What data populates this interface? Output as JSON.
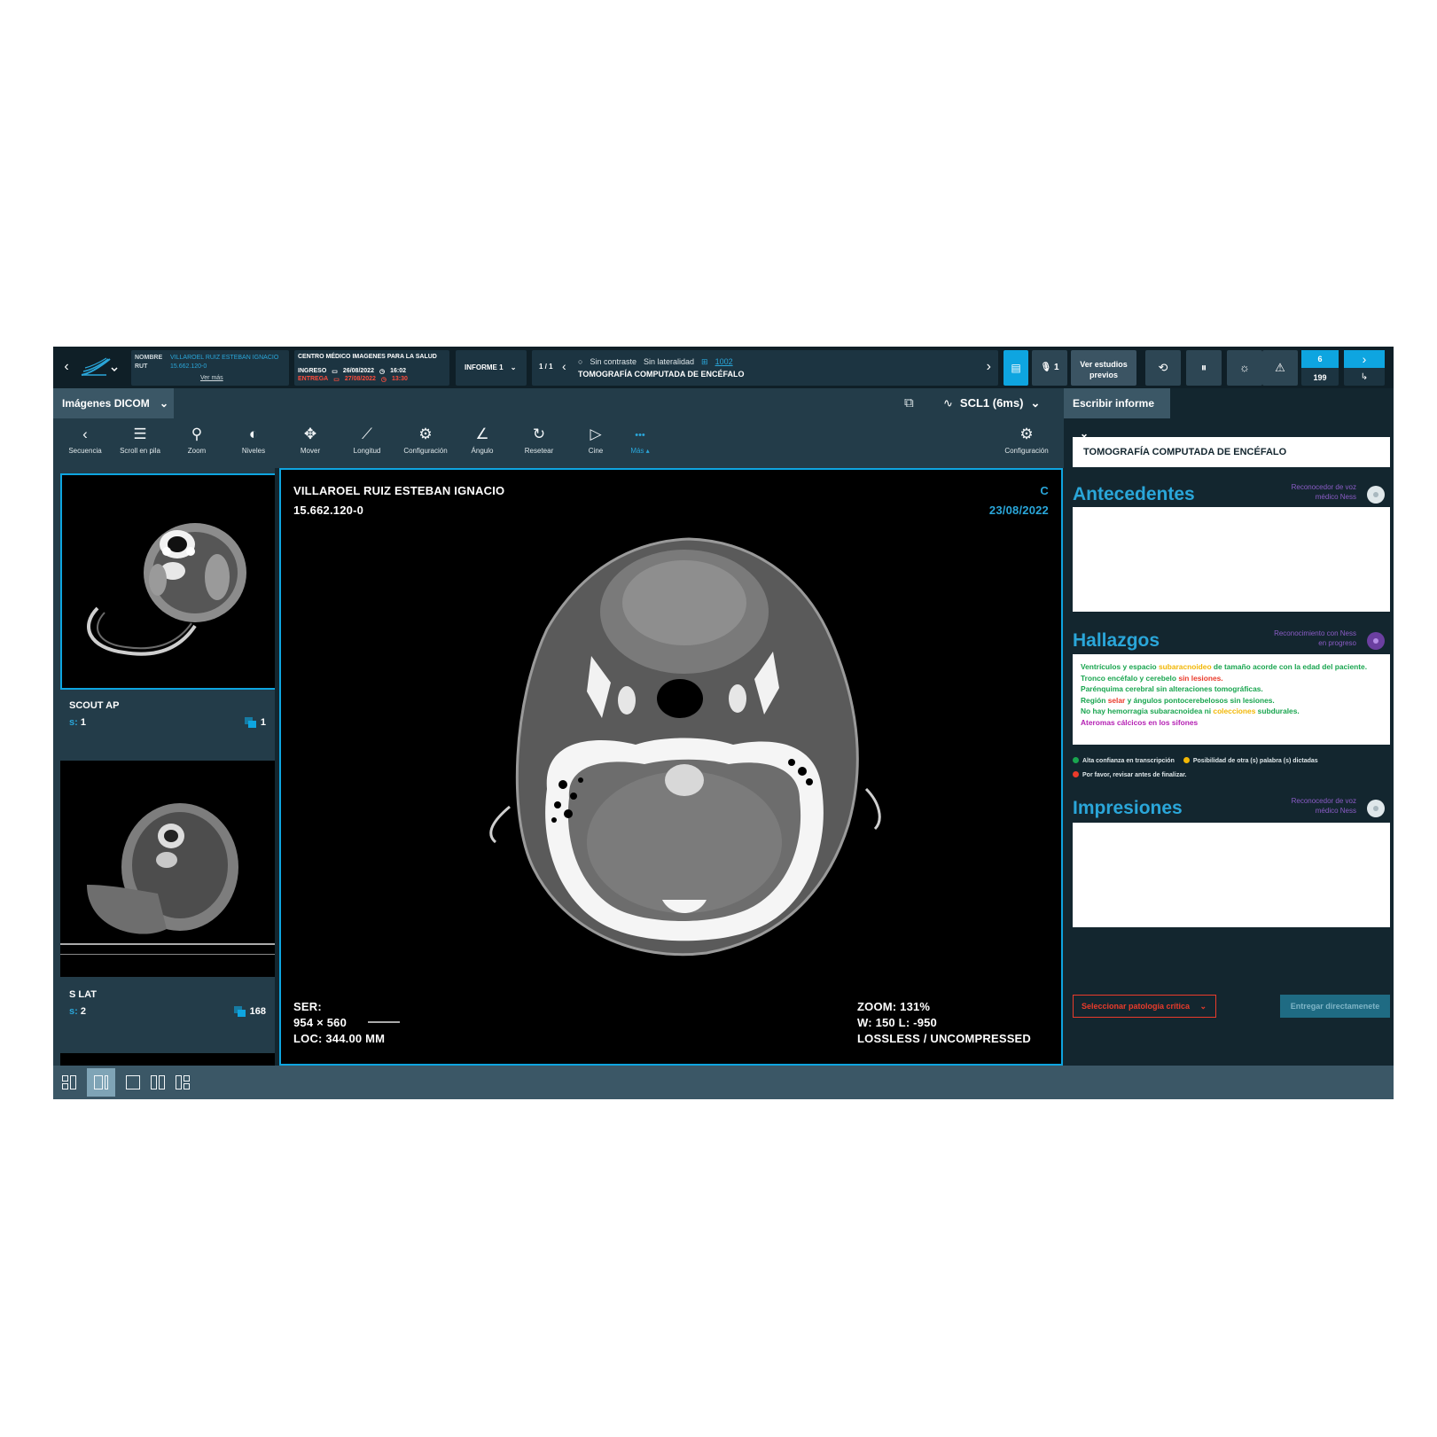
{
  "topbar": {
    "patient": {
      "name_label": "NOMBRE",
      "name": "VILLAROEL RUIZ ESTEBAN IGNACIO",
      "rut_label": "RUT",
      "rut": "15.662.120-0",
      "more": "Ver más"
    },
    "center": {
      "title": "CENTRO MÉDICO IMAGENES PARA LA SALUD",
      "ingreso_label": "INGRESO",
      "ingreso_date": "26/08/2022",
      "ingreso_time": "16:02",
      "entrega_label": "ENTREGA",
      "entrega_date": "27/08/2022",
      "entrega_time": "13:30"
    },
    "informe": "INFORME 1",
    "study": {
      "pager": "1 / 1",
      "contrast": "Sin contraste",
      "laterality": "Sin lateralidad",
      "code": "1002",
      "name": "TOMOGRAFÍA COMPUTADA DE ENCÉFALO"
    },
    "mic_count": "1",
    "prev_studies": [
      "Ver estudios",
      "previos"
    ],
    "counter_top": "6",
    "counter_bottom": "199"
  },
  "viewer": {
    "dropdown": "Imágenes DICOM",
    "series": "SCL1 (6ms)",
    "tools": [
      {
        "label": "Secuencia",
        "icon": "‹"
      },
      {
        "label": "Scroll en pila",
        "icon": "☰"
      },
      {
        "label": "Zoom",
        "icon": "⚲"
      },
      {
        "label": "Niveles",
        "icon": "◐"
      },
      {
        "label": "Mover",
        "icon": "✥"
      },
      {
        "label": "Longitud",
        "icon": "⟋"
      },
      {
        "label": "Configuración",
        "icon": "⚙"
      },
      {
        "label": "Ángulo",
        "icon": "∠"
      },
      {
        "label": "Resetear",
        "icon": "↻"
      },
      {
        "label": "Cine",
        "icon": "▷"
      },
      {
        "label": "Más ▴",
        "icon": "•••"
      }
    ],
    "config_label": "Configuración",
    "thumbnails": [
      {
        "title": "SCOUT AP",
        "s_label": "s:",
        "s": "1",
        "count": "1"
      },
      {
        "title": "S LAT",
        "s_label": "s:",
        "s": "2",
        "count": "168"
      }
    ],
    "overlay": {
      "patient_name": "VILLAROEL RUIZ ESTEBAN IGNACIO",
      "patient_rut": "15.662.120-0",
      "orientation": "C",
      "date": "23/08/2022",
      "ser": "SER:",
      "dims": "954 × 560",
      "loc": "LOC: 344.00 MM",
      "zoom": "ZOOM: 131%",
      "wl": "W: 150 L: -950",
      "compression": "LOSSLESS / UNCOMPRESSED"
    }
  },
  "report": {
    "dropdown": "Escribir informe",
    "title": "TOMOGRAFÍA COMPUTADA DE ENCÉFALO",
    "antecedentes": {
      "title": "Antecedentes",
      "voice": [
        "Reconocedor de voz",
        "médico Ness"
      ]
    },
    "hallazgos": {
      "title": "Hallazgos",
      "voice": [
        "Reconocimiento con Ness",
        "en progreso"
      ],
      "lines": {
        "l1a": "Ventrículos y espacio ",
        "l1b": "subaracnoideo",
        "l1c": " de tamaño acorde con la edad del paciente.",
        "l2a": "Tronco encéfalo y cerebelo ",
        "l2b": "sin lesiones.",
        "l3": "Parénquima cerebral sin alteraciones tomográficas.",
        "l4a": "Región ",
        "l4b": "selar",
        "l4c": " y ángulos pontocerebelosos sin lesiones.",
        "l5a": "No hay hemorragia subaracnoidea ni ",
        "l5b": "colecciones",
        "l5c": " subdurales.",
        "l6": "Ateromas cálcicos en los sifones"
      }
    },
    "legend": {
      "high": "Alta confianza en transcripción",
      "maybe": "Posibilidad de otra (s) palabra (s) dictadas",
      "review": "Por favor, revisar antes de finalizar."
    },
    "impresiones": {
      "title": "Impresiones",
      "voice": [
        "Reconocedor de voz",
        "médico Ness"
      ]
    },
    "critical": "Seleccionar patología crítica",
    "deliver": "Entregar directamenete"
  }
}
